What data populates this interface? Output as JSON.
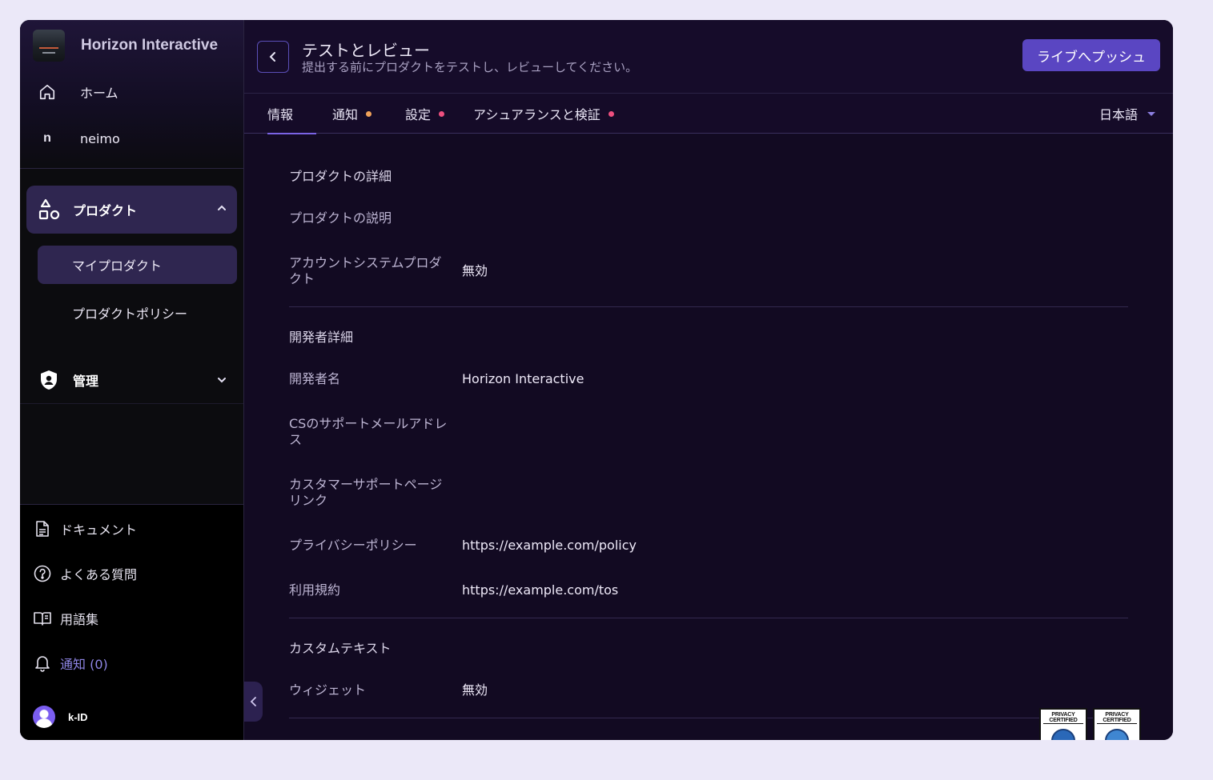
{
  "brand": {
    "name": "Horizon Interactive"
  },
  "nav": {
    "home": "ホーム",
    "workspace_letter": "n",
    "workspace": "neimo",
    "products_group": "プロダクト",
    "my_products": "マイプロダクト",
    "product_policy": "プロダクトポリシー",
    "admin_group": "管理"
  },
  "footer_nav": {
    "docs": "ドキュメント",
    "faq": "よくある質問",
    "glossary": "用語集",
    "notifications": "通知 (0)",
    "user": "k-ID"
  },
  "header": {
    "title": "テストとレビュー",
    "subtitle": "提出する前にプロダクトをテストし、レビューしてください。",
    "push_button": "ライブへプッシュ"
  },
  "tabs": [
    {
      "label": "情報",
      "active": true
    },
    {
      "label": "通知",
      "dot_color": "#f0a25a"
    },
    {
      "label": "設定",
      "dot_color": "#ee4f7f"
    },
    {
      "label": "アシュアランスと検証",
      "dot_color": "#ee4f7f"
    }
  ],
  "language": "日本語",
  "product_details": {
    "section_title": "プロダクトの詳細",
    "description_label": "プロダクトの説明",
    "account_system_label": "アカウントシステムプロダクト",
    "account_system_value": "無効"
  },
  "developer_details": {
    "section_title": "開発者詳細",
    "developer_name_label": "開発者名",
    "developer_name_value": "Horizon Interactive",
    "support_email_label": "CSのサポートメールアドレス",
    "support_page_label": "カスタマーサポートページリンク",
    "privacy_policy_label": "プライバシーポリシー",
    "privacy_policy_value": "https://example.com/policy",
    "terms_label": "利用規約",
    "terms_value": "https://example.com/tos"
  },
  "custom_text": {
    "section_title": "カスタムテキスト",
    "widget_label": "ウィジェット",
    "widget_value": "無効"
  },
  "badges": [
    {
      "label": "PRIVACY CERTIFIED",
      "icon": "globe-icon"
    },
    {
      "label": "PRIVACY CERTIFIED",
      "icon": "kids-icon"
    }
  ],
  "colors": {
    "accent": "#5a46c2",
    "sidebar_active": "#2f2650",
    "notification_link": "#8f86e6"
  }
}
